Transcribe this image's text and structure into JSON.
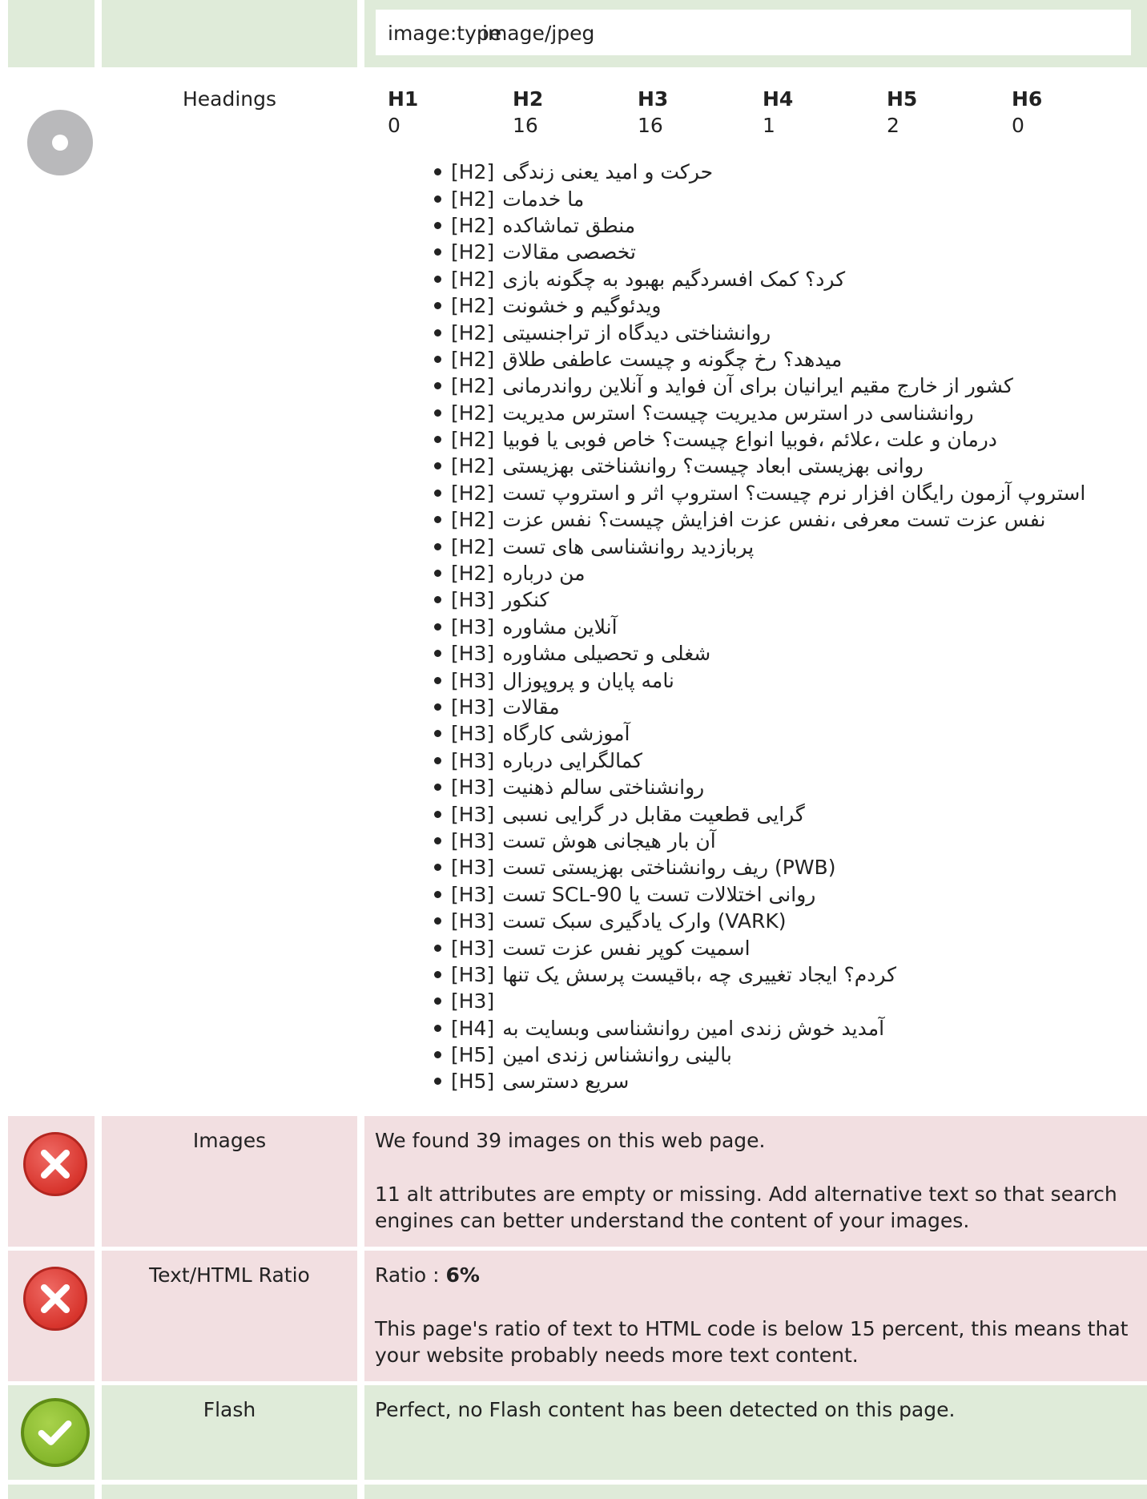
{
  "meta_row": {
    "key": "image:type",
    "value": "image/jpeg"
  },
  "headings": {
    "label": "Headings",
    "counts": [
      {
        "tag": "H1",
        "count": "0"
      },
      {
        "tag": "H2",
        "count": "16"
      },
      {
        "tag": "H3",
        "count": "16"
      },
      {
        "tag": "H4",
        "count": "1"
      },
      {
        "tag": "H5",
        "count": "2"
      },
      {
        "tag": "H6",
        "count": "0"
      }
    ],
    "list": [
      {
        "tag": "[H2]",
        "text": "حرکت و امید یعنی زندگی"
      },
      {
        "tag": "[H2]",
        "text": "ما خدمات"
      },
      {
        "tag": "[H2]",
        "text": "منطق تماشاکده"
      },
      {
        "tag": "[H2]",
        "text": "تخصصی مقالات"
      },
      {
        "tag": "[H2]",
        "text": "کرد؟ کمک افسردگیم بهبود به چگونه بازی"
      },
      {
        "tag": "[H2]",
        "text": "ویدئوگیم و خشونت"
      },
      {
        "tag": "[H2]",
        "text": "روانشناختی دیدگاه از تراجنسیتی"
      },
      {
        "tag": "[H2]",
        "text": "میدهد؟ رخ چگونه و چیست عاطفی طلاق"
      },
      {
        "tag": "[H2]",
        "text": "کشور از خارج مقیم ایرانیان برای آن فواید و آنلاین رواندرمانی"
      },
      {
        "tag": "[H2]",
        "text": "روانشناسی در استرس مدیریت چیست؟ استرس مدیریت"
      },
      {
        "tag": "[H2]",
        "text": "درمان و علت ،علائم ،فوبیا انواع چیست؟ خاص فوبی یا فوبیا"
      },
      {
        "tag": "[H2]",
        "text": "روانی بهزیستی ابعاد چیست؟ روانشناختی بهزیستی"
      },
      {
        "tag": "[H2]",
        "text": "استروپ آزمون رایگان افزار نرم چیست؟ استروپ اثر و استروپ تست"
      },
      {
        "tag": "[H2]",
        "text": "نفس عزت تست معرفی ،نفس عزت افزایش چیست؟ نفس عزت"
      },
      {
        "tag": "[H2]",
        "text": "پربازدید روانشناسی های تست"
      },
      {
        "tag": "[H2]",
        "text": "من درباره"
      },
      {
        "tag": "[H3]",
        "text": "کنکور"
      },
      {
        "tag": "[H3]",
        "text": "آنلاین مشاوره"
      },
      {
        "tag": "[H3]",
        "text": "شغلی و تحصیلی مشاوره"
      },
      {
        "tag": "[H3]",
        "text": "نامه پایان و پروپوزال"
      },
      {
        "tag": "[H3]",
        "text": "مقالات"
      },
      {
        "tag": "[H3]",
        "text": "آموزشی کارگاه"
      },
      {
        "tag": "[H3]",
        "text": "کمالگرایی درباره"
      },
      {
        "tag": "[H3]",
        "text": "روانشناختی سالم ذهنیت"
      },
      {
        "tag": "[H3]",
        "text": "گرایی قطعیت مقابل در گرایی نسبی"
      },
      {
        "tag": "[H3]",
        "text": "آن بار هیجانی هوش تست"
      },
      {
        "tag": "[H3]",
        "text": "(PWB) ریف روانشناختی بهزیستی تست"
      },
      {
        "tag": "[H3]",
        "text": "روانی اختلالات تست یا SCL-90 تست"
      },
      {
        "tag": "[H3]",
        "text": "(VARK) وارک یادگیری سبک تست"
      },
      {
        "tag": "[H3]",
        "text": "اسمیت کوپر نفس عزت تست"
      },
      {
        "tag": "[H3]",
        "text": "کردم؟ ایجاد تغییری چه ،باقیست پرسش یک تنها"
      },
      {
        "tag": "[H3]",
        "text": ""
      },
      {
        "tag": "[H4]",
        "text": "آمدید خوش زندی امین روانشناسی وبسایت به"
      },
      {
        "tag": "[H5]",
        "text": "بالینی روانشناس زندی امین"
      },
      {
        "tag": "[H5]",
        "text": "سریع دسترسی"
      }
    ]
  },
  "images": {
    "label": "Images",
    "line1": "We found 39 images on this web page.",
    "line2": "11 alt attributes are empty or missing. Add alternative text so that search engines can better understand the content of your images."
  },
  "ratio": {
    "label": "Text/HTML Ratio",
    "prefix": "Ratio : ",
    "value": "6%",
    "line2": "This page's ratio of text to HTML code is below 15 percent, this means that your website probably needs more text content."
  },
  "flash": {
    "label": "Flash",
    "line1": "Perfect, no Flash content has been detected on this page."
  },
  "icons": {
    "neutral": "info-neutral-icon",
    "error": "error-x-icon",
    "ok": "check-ok-icon"
  },
  "colors": {
    "green_bg": "#dfebd9",
    "red_bg": "#f2dfe1",
    "error": "#d8352d",
    "ok": "#84b62b"
  }
}
